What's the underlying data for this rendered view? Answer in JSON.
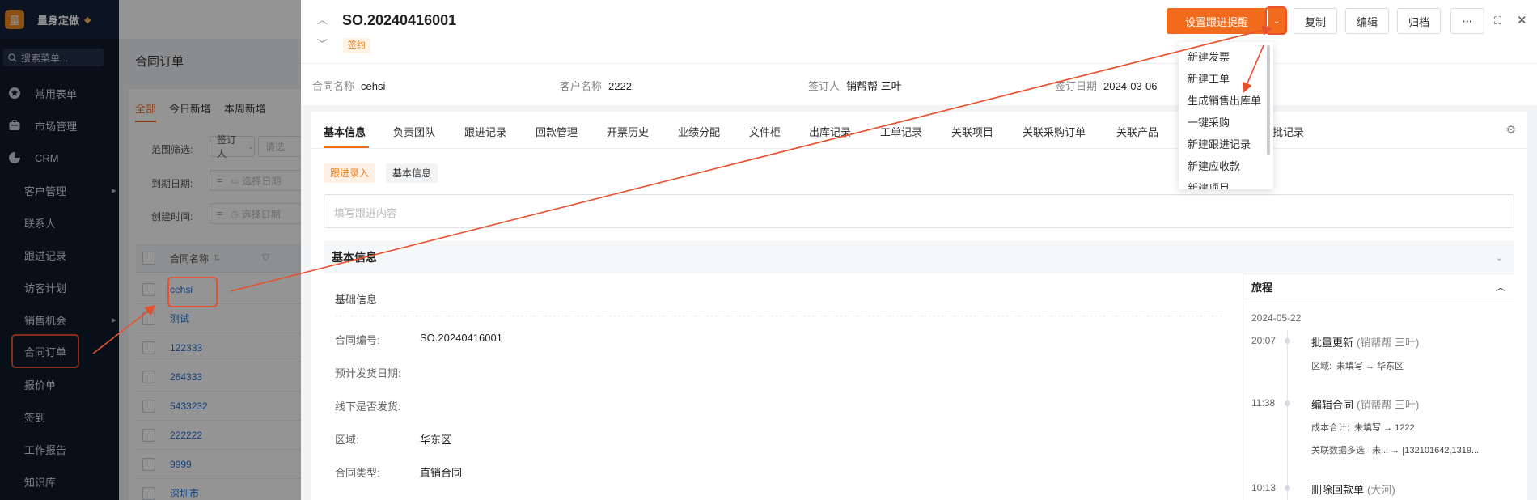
{
  "colors": {
    "accent": "#f26a1b",
    "annotation": "#e8502e",
    "sidebar_bg": "#0f1a2c",
    "link": "#1f6fd6"
  },
  "sidebar": {
    "logo_char": "量",
    "brand": "量身定做",
    "search_placeholder": "搜索菜单...",
    "groups": [
      {
        "label": "常用表单",
        "icon": "star-icon"
      },
      {
        "label": "市场管理",
        "icon": "briefcase-icon"
      },
      {
        "label": "CRM",
        "icon": "pie-chart-icon"
      }
    ],
    "items": [
      {
        "label": "客户管理",
        "has_children": true
      },
      {
        "label": "联系人"
      },
      {
        "label": "跟进记录"
      },
      {
        "label": "访客计划"
      },
      {
        "label": "销售机会",
        "has_children": true
      },
      {
        "label": "合同订单",
        "active": true
      },
      {
        "label": "报价单"
      },
      {
        "label": "签到"
      },
      {
        "label": "工作报告"
      },
      {
        "label": "知识库"
      }
    ]
  },
  "list_page": {
    "title": "合同订单",
    "tabs": [
      "全部",
      "今日新增",
      "本周新增"
    ],
    "filters": {
      "range_label": "范围筛选:",
      "range_value": "签订人",
      "range_placeholder": "请选",
      "due_label": "到期日期:",
      "due_placeholder": "选择日期",
      "created_label": "创建时间:",
      "created_placeholder": "选择日期"
    },
    "column_header": "合同名称",
    "rows": [
      "cehsi",
      "测试",
      "122333",
      "264333",
      "5433232",
      "222222",
      "9999",
      "深圳市"
    ]
  },
  "detail": {
    "order_no": "SO.20240416001",
    "status_tag": "签约",
    "actions": {
      "primary": "设置跟进提醒",
      "copy": "复制",
      "edit": "编辑",
      "archive": "归档",
      "more": "···"
    },
    "summary": [
      {
        "key": "合同名称",
        "value": "cehsi"
      },
      {
        "key": "客户名称",
        "value": "2222"
      },
      {
        "key": "签订人",
        "value": "销帮帮 三叶"
      },
      {
        "key": "签订日期",
        "value": "2024-03-06"
      }
    ],
    "tabs": [
      "基本信息",
      "负责团队",
      "跟进记录",
      "回款管理",
      "开票历史",
      "业绩分配",
      "文件柜",
      "出库记录",
      "工单记录",
      "关联项目",
      "关联采购订单",
      "关联产品",
      "批记录"
    ],
    "pills": {
      "followup": "跟进录入",
      "basic": "基本信息"
    },
    "followup_placeholder": "填写跟进内容",
    "section_title": "基本信息",
    "subsection_title": "基础信息",
    "fields": [
      {
        "key": "合同编号:",
        "value": "SO.20240416001"
      },
      {
        "key": "预计发货日期:",
        "value": ""
      },
      {
        "key": "线下是否发货:",
        "value": ""
      },
      {
        "key": "区域:",
        "value": "华东区"
      },
      {
        "key": "合同类型:",
        "value": "直销合同"
      }
    ],
    "journey": {
      "title": "旅程",
      "date": "2024-05-22",
      "events": [
        {
          "time": "20:07",
          "action": "批量更新",
          "who": "(销帮帮 三叶)",
          "details": [
            {
              "key": "区域:",
              "value": "未填写 → 华东区"
            }
          ]
        },
        {
          "time": "11:38",
          "action": "编辑合同",
          "who": "(销帮帮 三叶)",
          "details": [
            {
              "key": "成本合计:",
              "value": "未填写 → 1222"
            },
            {
              "key": "关联数据多选:",
              "value": "未...  → [132101642,1319..."
            }
          ]
        },
        {
          "time": "10:13",
          "action": "删除回款单",
          "who": "(大河)",
          "details": []
        }
      ]
    }
  },
  "dropdown_menu": [
    "新建发票",
    "新建工单",
    "生成销售出库单",
    "一键采购",
    "新建跟进记录",
    "新建应收款",
    "新建项目"
  ]
}
